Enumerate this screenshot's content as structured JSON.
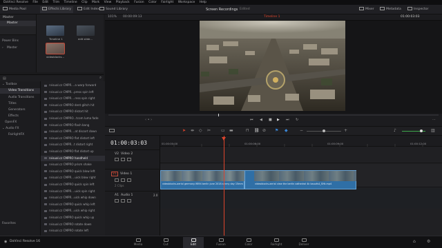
{
  "app": {
    "name": "DaVinci Resolve",
    "brand_label": "DaVinci Resolve 16"
  },
  "menu": [
    "DaVinci Resolve",
    "File",
    "Edit",
    "Trim",
    "Timeline",
    "Clip",
    "Mark",
    "View",
    "Playback",
    "Fusion",
    "Color",
    "Fairlight",
    "Workspace",
    "Help"
  ],
  "toolbar": {
    "media_pool": "Media Pool",
    "effects_library": "Effects Library",
    "edit_index": "Edit Index",
    "sound_library": "Sound Library",
    "project_title": "Screen Recordings",
    "project_status": "Edited",
    "mixer": "Mixer",
    "metadata": "Metadata",
    "inspector": "Inspector"
  },
  "media_pool": {
    "root_label": "Master",
    "selected_bin": "Master",
    "power_bins": "Power Bins",
    "power_bins_master": "Master",
    "clips": [
      {
        "name": "Timeline 1",
        "color": "#4a5a6e"
      },
      {
        "name": "edit slide...",
        "color": "#3a4048"
      },
      {
        "name": "videoblocks...",
        "color": "#7a6a62"
      }
    ]
  },
  "viewer": {
    "zoom": "101%",
    "source_tc": "00:00:09:13",
    "timeline_name": "Timeline 1",
    "record_tc": "01:00:03:03"
  },
  "effects": {
    "toolbox": "Toolbox",
    "categories": [
      "Video Transitions",
      "Audio Transitions",
      "Titles",
      "Generators",
      "Effects",
      "OpenFX",
      "Audio FX",
      "FairlightFX"
    ],
    "selected_category": "Video Transitions",
    "favorites": "Favorites",
    "items": [
      "rvisual.cz CMPR....a warp forward",
      "rvisual.cz CMPR...press spin left",
      "rvisual.cz CMPR....ress spin right",
      "rvisual.cz CMPRO dent glitch hit",
      "rvisual.cz CMPRO distort hit",
      "rvisual.cz CMPRO...tcom luma fade",
      "rvisual.cz CMPRO flash bang",
      "rvisual.cz CMPR....at discort down",
      "rvisual.cz CMPRO flat distort left",
      "rvisual.cz CMPR...t distort right",
      "rvisual.cz CMPRO flat distort up",
      "rvisual.cz CMPRO handheld",
      "rvisual.cz CMPRO prism shake",
      "rvisual.cz CMPRO quick blow left",
      "rvisual.cz CMPR....uick blow right",
      "rvisual.cz CMPRO quick spin left",
      "rvisual.cz CMPR....uick spin right",
      "rvisual.cz CMPR...uick whip down",
      "rvisual.cz CMPRO quick whip left",
      "rvisual.cz CMPR...uick whip right",
      "rvisual.cz CMPRO quick whip up",
      "rvisual.cz CMPRO rotate down",
      "rvisual.cz CMPRO rotate left"
    ],
    "selected_index": 11
  },
  "timeline": {
    "timecode": "01:00:03:03",
    "ruler_marks": [
      "01:00:00:00",
      "01:00:06:00",
      "01:00:09:00",
      "01:00:12:00"
    ],
    "playhead_fraction": 0.23,
    "tracks": {
      "v2": {
        "id": "V2",
        "name": "Video 2"
      },
      "v1": {
        "id": "V1",
        "name": "Video 1",
        "clip_count": "2 Clips"
      },
      "a1": {
        "id": "A1",
        "name": "Audio 1",
        "channels": "2.0"
      }
    },
    "clip1_label": "videoblocks-aerial germany-9894 berlin june 2018 a-nmy day 15mm wide...",
    "clip2_label": "videoblocks-aerial view the berlin cathedral 4k bauufs4_SHk.mp4",
    "track_colors": {
      "clip": "#2f6fa6",
      "playhead": "#e0452c",
      "transition": "#c9c9c9"
    }
  },
  "pages": [
    "Media",
    "Cut",
    "Edit",
    "Fusion",
    "Color",
    "Fairlight",
    "Deliver"
  ],
  "active_page": "Edit"
}
